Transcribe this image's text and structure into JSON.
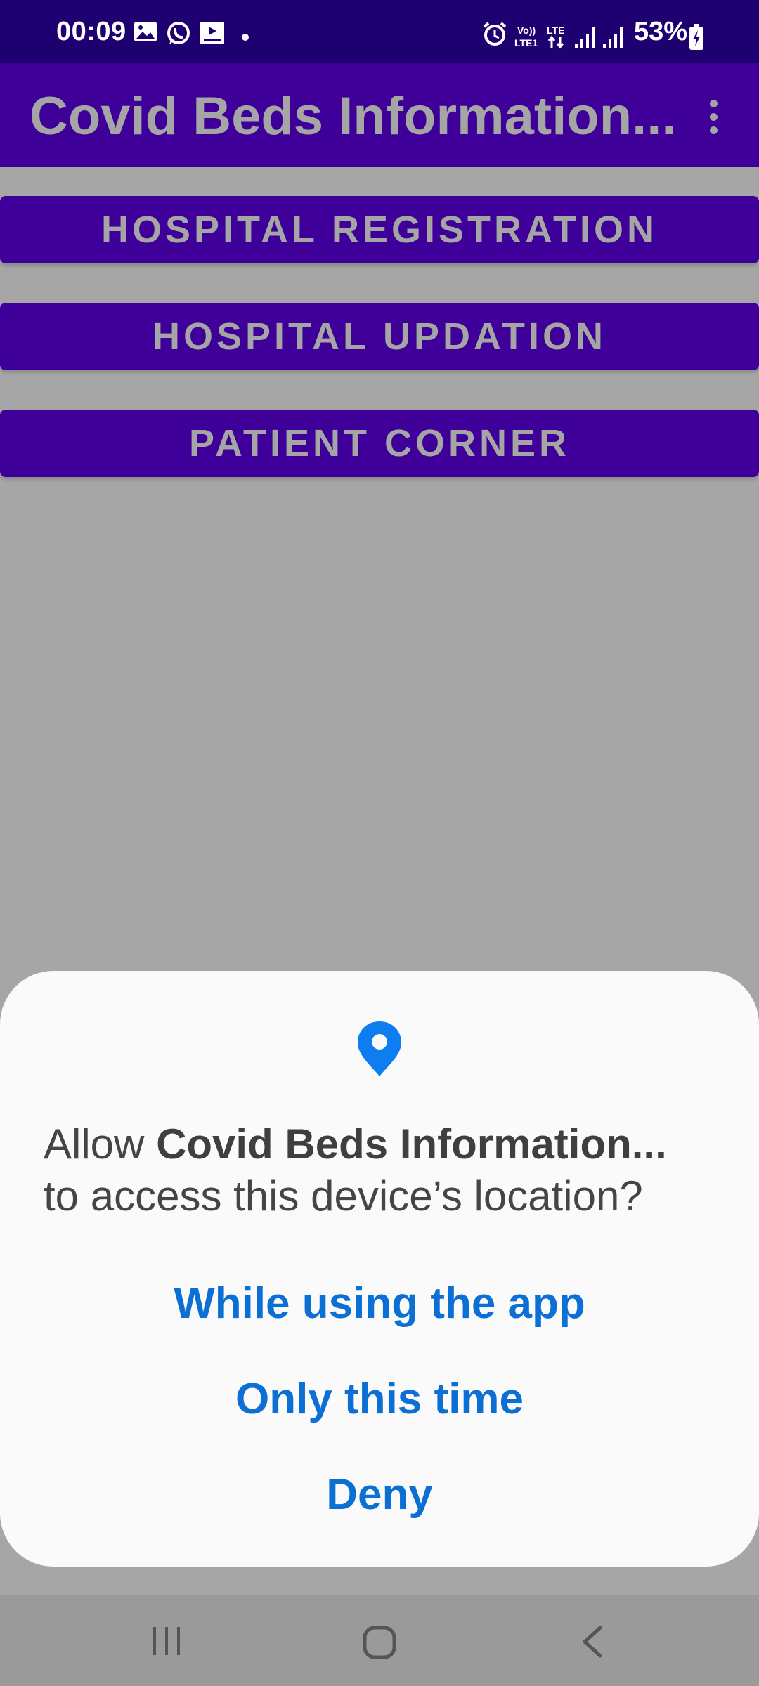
{
  "status_bar": {
    "time": "00:09",
    "battery": "53%",
    "icons": [
      "gallery-icon",
      "whatsapp-icon",
      "media-icon",
      "dot-icon",
      "alarm-icon",
      "volte-icon",
      "lte-icon",
      "signal-icon",
      "signal-icon",
      "battery-charging-icon"
    ]
  },
  "app_bar": {
    "title": "Covid Beds Information..."
  },
  "buttons": {
    "registration": "HOSPITAL REGISTRATION",
    "updation": "HOSPITAL UPDATION",
    "patient": "PATIENT CORNER"
  },
  "dialog": {
    "prefix": "Allow ",
    "app_name": "Covid Beds Information...",
    "suffix": "to access this device’s location?",
    "options": [
      "While using the app",
      "Only this time",
      "Deny"
    ]
  },
  "colors": {
    "status_bar": "#1f0070",
    "primary": "#3e0098",
    "accent_text": "#0c6fd4",
    "scrim": "#a6a6a6"
  }
}
